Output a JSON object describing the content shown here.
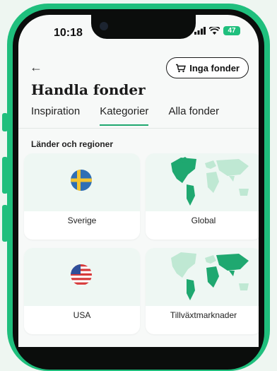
{
  "status": {
    "time": "10:18",
    "battery": "47"
  },
  "header": {
    "back_icon": "back-arrow-icon",
    "pill_label": "Inga fonder",
    "pill_icon": "cart-icon"
  },
  "page_title": "Handla fonder",
  "tabs": [
    {
      "label": "Inspiration",
      "active": false
    },
    {
      "label": "Kategorier",
      "active": true
    },
    {
      "label": "Alla fonder",
      "active": false
    }
  ],
  "section_title": "Länder och regioner",
  "cards": [
    {
      "label": "Sverige",
      "icon": "sweden-flag-icon"
    },
    {
      "label": "Global",
      "icon": "world-map-icon"
    },
    {
      "label": "USA",
      "icon": "usa-flag-icon"
    },
    {
      "label": "Tillväxtmarknader",
      "icon": "emerging-markets-map-icon"
    }
  ],
  "colors": {
    "accent": "#1fbf7d",
    "tab_underline": "#1fa870",
    "map_dark": "#1fa870",
    "map_light": "#bfe8d3"
  }
}
